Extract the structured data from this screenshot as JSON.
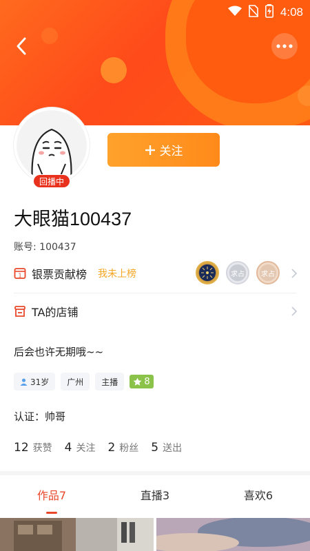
{
  "status_bar": {
    "time": "4:08"
  },
  "profile": {
    "replay_badge": "回播中",
    "follow_label": "关注",
    "name": "大眼猫100437",
    "account": "账号: 100437"
  },
  "rows": {
    "contribution": {
      "label": "银票贡献榜",
      "tag": "我未上榜",
      "medals": [
        "",
        "求占",
        "求占"
      ]
    },
    "shop": {
      "label": "TA的店铺"
    }
  },
  "bio": "后会也许无期哦~~",
  "tags": {
    "age": "31岁",
    "city": "广州",
    "role": "主播",
    "level": "8"
  },
  "verify": "认证：帅哥",
  "stats": [
    {
      "num": "12",
      "label": "获赞"
    },
    {
      "num": "4",
      "label": "关注"
    },
    {
      "num": "2",
      "label": "粉丝"
    },
    {
      "num": "5",
      "label": "送出"
    }
  ],
  "tabs": [
    {
      "label": "作品7",
      "active": true
    },
    {
      "label": "直播3",
      "active": false
    },
    {
      "label": "喜欢6",
      "active": false
    }
  ],
  "colors": {
    "banner": "#ff5a14",
    "accent": "#e8472a",
    "follow": "#ff9a24",
    "tag_text": "#f5a623"
  }
}
